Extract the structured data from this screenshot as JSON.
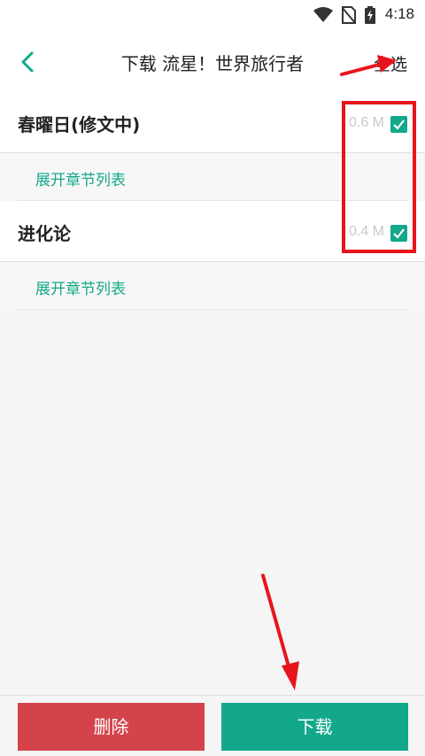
{
  "status_bar": {
    "time": "4:18",
    "icons": [
      "wifi-icon",
      "no-sim-icon",
      "battery-charging-icon"
    ]
  },
  "header": {
    "title": "下载 流星！世界旅行者",
    "select_all_label": "全选"
  },
  "books": [
    {
      "title": "春曜日(修文中)",
      "size": "0.6 M",
      "checked": true,
      "expand_label": "展开章节列表"
    },
    {
      "title": "进化论",
      "size": "0.4 M",
      "checked": true,
      "expand_label": "展开章节列表"
    }
  ],
  "bottom_bar": {
    "delete_label": "删除",
    "download_label": "下载"
  },
  "colors": {
    "accent": "#13a88a",
    "danger": "#d4434a",
    "annotation": "#e8141c"
  }
}
